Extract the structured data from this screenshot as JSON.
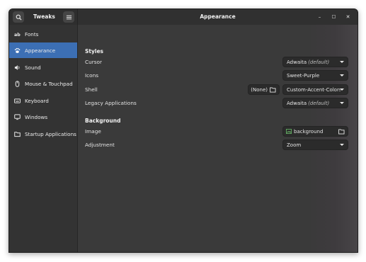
{
  "app": {
    "title": "Tweaks"
  },
  "page": {
    "title": "Appearance"
  },
  "header": {
    "search_icon": "search-icon",
    "menu_icon": "hamburger-menu-icon"
  },
  "window_controls": {
    "minimize": "–",
    "maximize": "□",
    "close": "✕"
  },
  "sidebar": {
    "items": [
      {
        "label": "Fonts",
        "icon": "font-icon",
        "active": false
      },
      {
        "label": "Appearance",
        "icon": "paw-icon",
        "active": true
      },
      {
        "label": "Sound",
        "icon": "speaker-icon",
        "active": false
      },
      {
        "label": "Mouse & Touchpad",
        "icon": "mouse-icon",
        "active": false
      },
      {
        "label": "Keyboard",
        "icon": "keyboard-icon",
        "active": false
      },
      {
        "label": "Windows",
        "icon": "monitor-icon",
        "active": false
      },
      {
        "label": "Startup Applications",
        "icon": "folder-icon",
        "active": false
      }
    ]
  },
  "styles": {
    "heading": "Styles",
    "cursor": {
      "label": "Cursor",
      "value": "Adwaita",
      "note": "(default)"
    },
    "icons": {
      "label": "Icons",
      "value": "Sweet-Purple"
    },
    "shell": {
      "label": "Shell",
      "none_button": "(None)",
      "value": "Custom-Accent-Colors"
    },
    "legacy": {
      "label": "Legacy Applications",
      "value": "Adwaita",
      "note": "(default)"
    }
  },
  "background": {
    "heading": "Background",
    "image": {
      "label": "Image",
      "value": "background"
    },
    "adjustment": {
      "label": "Adjustment",
      "value": "Zoom"
    }
  },
  "colors": {
    "accent": "#3c6fb4",
    "window_bg": "#3a3a3a",
    "sidebar_bg": "#333333"
  }
}
